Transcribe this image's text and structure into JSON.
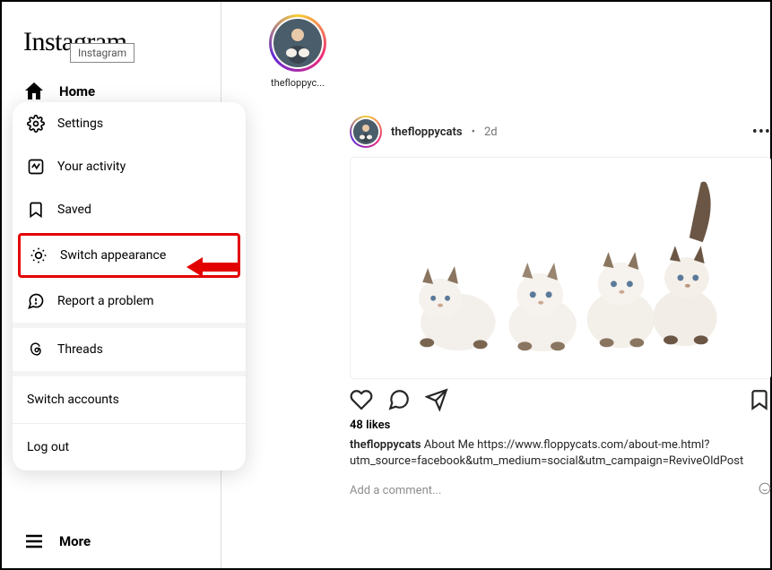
{
  "brand": {
    "logo_text": "Instagram",
    "tooltip": "Instagram"
  },
  "sidebar": {
    "home": "Home",
    "more": "More"
  },
  "more_menu": {
    "settings": "Settings",
    "activity": "Your activity",
    "saved": "Saved",
    "switch_appearance": "Switch appearance",
    "report": "Report a problem",
    "threads": "Threads",
    "switch_accounts": "Switch accounts",
    "logout": "Log out"
  },
  "stories": [
    {
      "username": "thefloppyc..."
    }
  ],
  "post": {
    "username": "thefloppycats",
    "separator": "•",
    "time": "2d",
    "likes": "48 likes",
    "caption_user": "thefloppycats",
    "caption_text": " About Me https://www.floppycats.com/about-me.html?utm_source=facebook&utm_medium=social&utm_campaign=ReviveOldPost",
    "comment_placeholder": "Add a comment..."
  }
}
